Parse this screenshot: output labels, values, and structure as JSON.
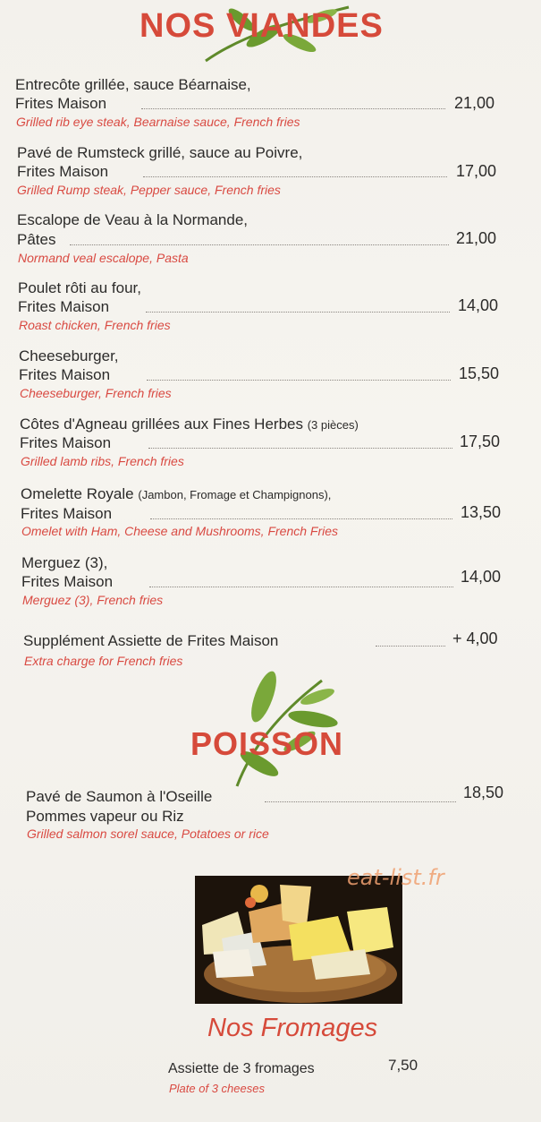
{
  "sections": {
    "viandes": {
      "title": "NOS VIANDES",
      "items": [
        {
          "fr": "Entrecôte grillée, sauce Béarnaise,",
          "fr2": "Frites Maison",
          "en": "Grilled rib eye steak, Bearnaise sauce, French fries",
          "price": "21,00"
        },
        {
          "fr": "Pavé de Rumsteck grillé, sauce au Poivre,",
          "fr2": "Frites Maison",
          "en": "Grilled Rump steak, Pepper sauce, French fries",
          "price": "17,00"
        },
        {
          "fr": "Escalope de Veau à la Normande,",
          "fr2": "Pâtes",
          "en": "Normand veal escalope, Pasta",
          "price": "21,00"
        },
        {
          "fr": "Poulet rôti au four,",
          "fr2": "Frites Maison",
          "en": "Roast chicken, French fries",
          "price": "14,00"
        },
        {
          "fr": "Cheeseburger,",
          "fr2": "Frites Maison",
          "en": "Cheeseburger, French fries",
          "price": "15,50"
        },
        {
          "fr": "Côtes d'Agneau grillées aux Fines Herbes",
          "fr_note": "(3 pièces)",
          "fr2": "Frites Maison",
          "en": "Grilled lamb ribs, French fries",
          "price": "17,50"
        },
        {
          "fr": "Omelette Royale",
          "fr_note": "(Jambon, Fromage et Champignons),",
          "fr2": "Frites Maison",
          "en": "Omelet with Ham, Cheese and Mushrooms, French Fries",
          "price": "13,50"
        },
        {
          "fr": "Merguez (3),",
          "fr2": "Frites Maison",
          "en": "Merguez (3), French fries",
          "price": "14,00"
        }
      ],
      "supplement": {
        "fr": "Supplément Assiette de Frites Maison",
        "en": "Extra charge for French fries",
        "price": "+ 4,00"
      }
    },
    "poisson": {
      "title": "POISSON",
      "item": {
        "fr": "Pavé de Saumon à l'Oseille",
        "fr2": "Pommes vapeur ou Riz",
        "en": "Grilled salmon sorel sauce, Potatoes or rice",
        "price": "18,50"
      }
    },
    "fromages": {
      "title": "Nos Fromages",
      "item": {
        "fr": "Assiette de 3 fromages",
        "en": "Plate of 3 cheeses",
        "price": "7,50"
      }
    }
  },
  "watermark": "eat-list.fr",
  "colors": {
    "accent": "#d64a3a",
    "english_text": "#d94a42",
    "leaf": "#6a9a2e"
  }
}
